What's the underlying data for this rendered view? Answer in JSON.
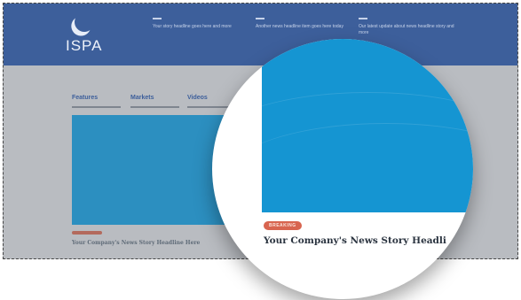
{
  "header": {
    "logo_text": "ISPA",
    "nav": [
      {
        "text": "Your story headline goes here and more"
      },
      {
        "text": "Another news headline item goes here today"
      },
      {
        "text": "Our latest update about news headline story and more"
      }
    ]
  },
  "tabs": [
    {
      "label": "Features"
    },
    {
      "label": "Markets"
    },
    {
      "label": "Videos"
    }
  ],
  "card": {
    "badge": "",
    "title": "Your Company's News Story Headline Here"
  },
  "magnifier": {
    "badge": "BREAKING",
    "title": "Your Company's News Story Headli"
  },
  "colors": {
    "header": "#3d5f9b",
    "image": "#1595d2",
    "badge": "#d86550"
  }
}
